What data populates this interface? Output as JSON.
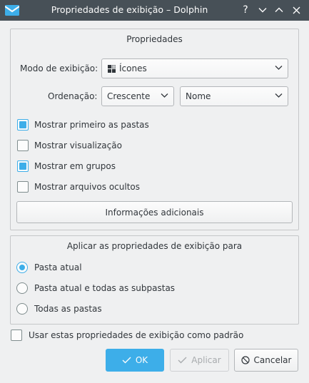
{
  "window": {
    "title": "Propriedades de exibição – Dolphin",
    "help_glyph": "?"
  },
  "properties": {
    "title": "Propriedades",
    "view_mode_label": "Modo de exibição:",
    "view_mode_value": "Ícones",
    "sorting_label": "Ordenação:",
    "sort_order_value": "Crescente",
    "sort_by_value": "Nome",
    "checkboxes": [
      {
        "label": "Mostrar primeiro as pastas",
        "checked": true
      },
      {
        "label": "Mostrar visualização",
        "checked": false
      },
      {
        "label": "Mostrar em grupos",
        "checked": true
      },
      {
        "label": "Mostrar arquivos ocultos",
        "checked": false
      }
    ],
    "additional_info_button": "Informações adicionais"
  },
  "apply": {
    "title": "Aplicar as propriedades de exibição para",
    "radios": [
      {
        "label": "Pasta atual",
        "selected": true
      },
      {
        "label": "Pasta atual e todas as subpastas",
        "selected": false
      },
      {
        "label": "Todas as pastas",
        "selected": false
      }
    ]
  },
  "default_checkbox": {
    "label": "Usar estas propriedades de exibição como padrão",
    "checked": false
  },
  "buttons": {
    "ok": "OK",
    "apply": "Aplicar",
    "cancel": "Cancelar"
  },
  "colors": {
    "titlebar": "#475057",
    "accent": "#3daee9",
    "background": "#eff0f1"
  }
}
